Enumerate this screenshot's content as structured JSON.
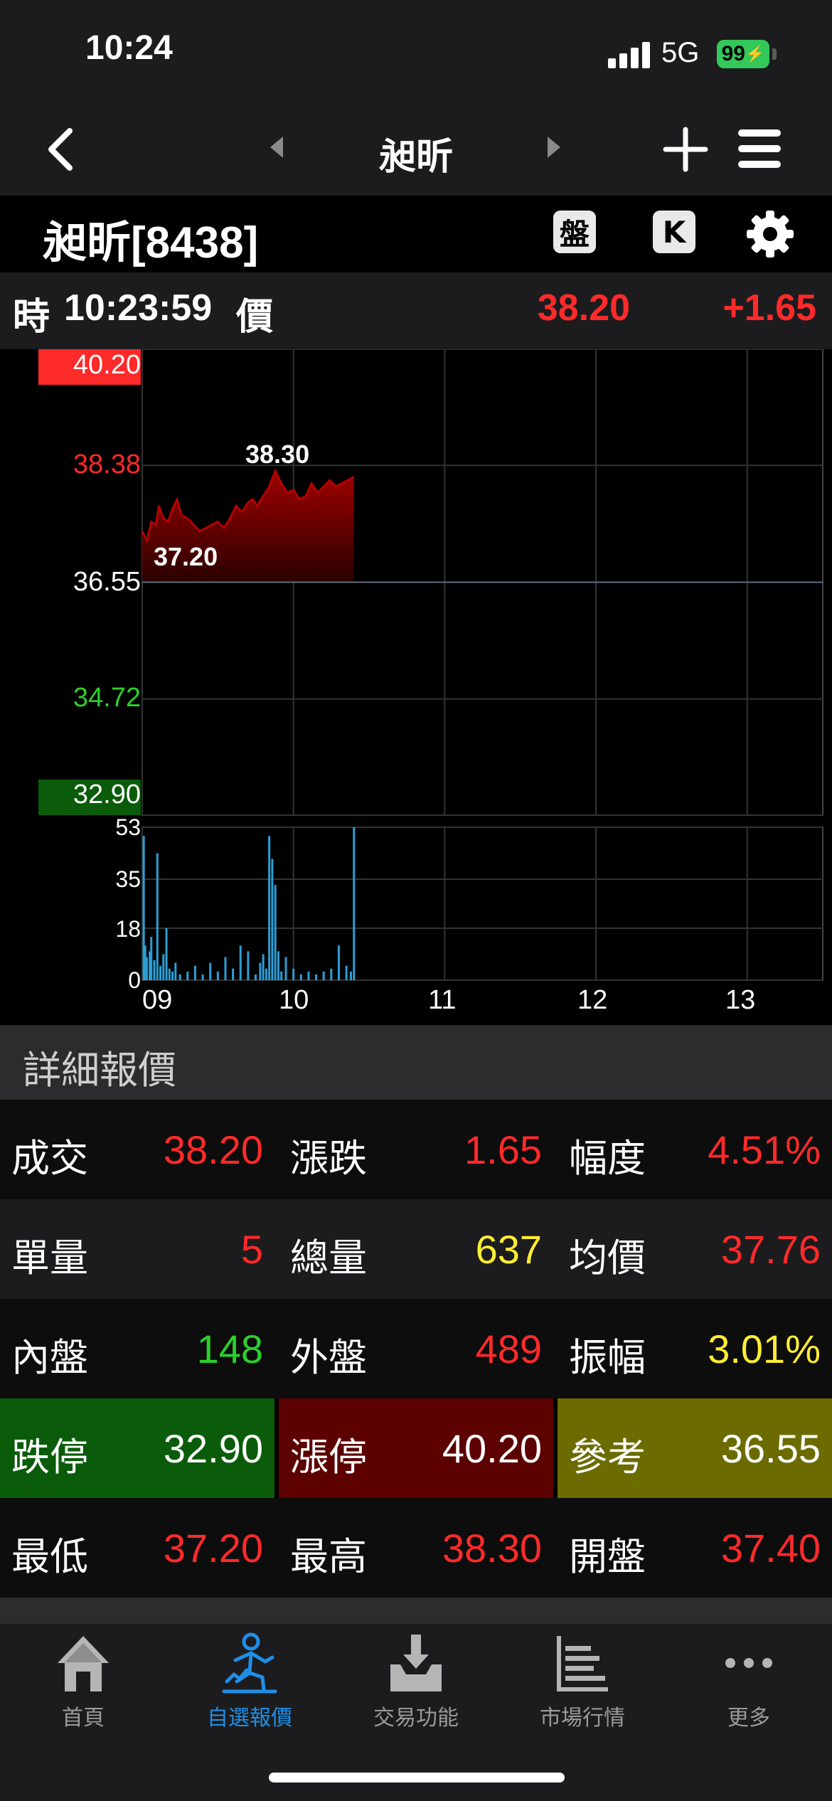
{
  "status_bar": {
    "time": "10:24",
    "network": "5G",
    "battery": "99"
  },
  "nav": {
    "title": "昶昕"
  },
  "stock": {
    "title": "昶昕[8438]",
    "btn_pan": "盤",
    "btn_k": "K"
  },
  "quote_line": {
    "time_prefix": "時",
    "time": "10:23:59",
    "price_label": "價",
    "price": "38.20",
    "change": "+1.65"
  },
  "colors": {
    "up": "#ff2a2a",
    "down": "#2bd12b",
    "flat": "#ffffff",
    "volume": "#2a9fd6",
    "highlight": "#ffee33",
    "limit_down_bg": "#0a5c0a",
    "limit_up_bg": "#5c0000",
    "reference_bg": "#6b6b00"
  },
  "chart_data": {
    "type": "area",
    "y_ticks": [
      {
        "value": "40.20",
        "kind": "limit-up"
      },
      {
        "value": "38.38",
        "kind": "up"
      },
      {
        "value": "36.55",
        "kind": "reference"
      },
      {
        "value": "34.72",
        "kind": "down"
      },
      {
        "value": "32.90",
        "kind": "limit-down"
      }
    ],
    "x_ticks": [
      "09",
      "10",
      "11",
      "12",
      "13"
    ],
    "ylim": [
      32.9,
      40.2
    ],
    "xlim": [
      9.0,
      13.5
    ],
    "reference": 36.55,
    "high_label": "38.30",
    "low_label": "37.20",
    "high": {
      "x": 9.88,
      "y": 38.3
    },
    "low": {
      "x": 9.03,
      "y": 37.2
    },
    "series": [
      {
        "x": [
          9.0,
          9.03,
          9.06,
          9.09,
          9.11,
          9.14,
          9.17,
          9.2,
          9.23,
          9.26,
          9.3,
          9.34,
          9.38,
          9.42,
          9.46,
          9.5,
          9.54,
          9.58,
          9.62,
          9.66,
          9.7,
          9.73,
          9.76,
          9.8,
          9.84,
          9.88,
          9.92,
          9.96,
          10.0,
          10.04,
          10.08,
          10.12,
          10.16,
          10.2,
          10.24,
          10.28,
          10.32,
          10.36,
          10.4
        ],
        "y": [
          37.35,
          37.2,
          37.5,
          37.45,
          37.75,
          37.55,
          37.5,
          37.7,
          37.85,
          37.6,
          37.55,
          37.45,
          37.35,
          37.4,
          37.45,
          37.5,
          37.4,
          37.55,
          37.75,
          37.65,
          37.8,
          37.85,
          37.75,
          37.9,
          38.05,
          38.3,
          38.1,
          37.95,
          38.0,
          37.85,
          37.9,
          38.1,
          37.95,
          38.05,
          38.15,
          38.05,
          38.1,
          38.15,
          38.2
        ]
      }
    ],
    "volume": {
      "y_ticks": [
        "53",
        "35",
        "18",
        "0"
      ],
      "ylim": [
        0,
        53
      ],
      "x": [
        9.01,
        9.02,
        9.03,
        9.05,
        9.06,
        9.08,
        9.1,
        9.12,
        9.14,
        9.16,
        9.18,
        9.2,
        9.22,
        9.25,
        9.3,
        9.35,
        9.4,
        9.45,
        9.5,
        9.55,
        9.6,
        9.65,
        9.7,
        9.75,
        9.78,
        9.8,
        9.82,
        9.84,
        9.86,
        9.88,
        9.9,
        9.92,
        9.95,
        10.0,
        10.05,
        10.1,
        10.15,
        10.2,
        10.25,
        10.3,
        10.35,
        10.38,
        10.4
      ],
      "values": [
        50,
        12,
        8,
        10,
        15,
        7,
        44,
        5,
        9,
        18,
        4,
        3,
        6,
        2,
        3,
        5,
        2,
        6,
        3,
        8,
        4,
        12,
        10,
        2,
        6,
        9,
        4,
        50,
        42,
        33,
        10,
        3,
        8,
        4,
        2,
        3,
        2,
        3,
        4,
        12,
        5,
        3,
        53
      ]
    }
  },
  "detail": {
    "header": "詳細報價",
    "rows": [
      [
        {
          "label": "成交",
          "value": "38.20"
        },
        {
          "label": "漲跌",
          "value": "1.65"
        },
        {
          "label": "幅度",
          "value": "4.51%"
        }
      ],
      [
        {
          "label": "單量",
          "value": "5"
        },
        {
          "label": "總量",
          "value": "637"
        },
        {
          "label": "均價",
          "value": "37.76"
        }
      ],
      [
        {
          "label": "內盤",
          "value": "148"
        },
        {
          "label": "外盤",
          "value": "489"
        },
        {
          "label": "振幅",
          "value": "3.01%"
        }
      ],
      [
        {
          "label": "跌停",
          "value": "32.90"
        },
        {
          "label": "漲停",
          "value": "40.20"
        },
        {
          "label": "參考",
          "value": "36.55"
        }
      ],
      [
        {
          "label": "最低",
          "value": "37.20"
        },
        {
          "label": "最高",
          "value": "38.30"
        },
        {
          "label": "開盤",
          "value": "37.40"
        }
      ]
    ]
  },
  "tabs": [
    {
      "label": "首頁",
      "icon": "home-icon"
    },
    {
      "label": "自選報價",
      "icon": "watchlist-person-icon",
      "active": true
    },
    {
      "label": "交易功能",
      "icon": "trade-download-icon"
    },
    {
      "label": "市場行情",
      "icon": "market-bars-icon"
    },
    {
      "label": "更多",
      "icon": "more-dots-icon"
    }
  ]
}
